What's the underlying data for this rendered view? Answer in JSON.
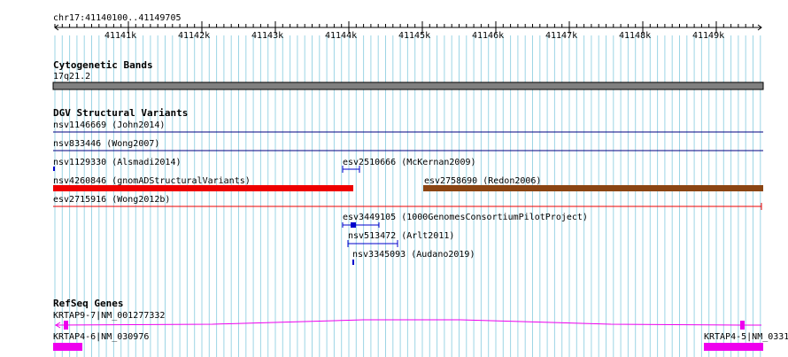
{
  "coords": "chr17:41140100..41149705",
  "ruler_ticks": [
    "41141k",
    "41142k",
    "41143k",
    "41144k",
    "41145k",
    "41146k",
    "41147k",
    "41148k",
    "41149k"
  ],
  "colors": {
    "grid": "#9dd5e5",
    "band": "#808080",
    "dgv_line": "#000080",
    "gnomad": "#ee0000",
    "redon": "#8b4513",
    "blue": "#0000cc",
    "refseq": "#ee00ee"
  },
  "tracks": {
    "cytoband": {
      "title": "Cytogenetic Bands",
      "band_label": "17q21.2"
    },
    "dgv": {
      "title": "DGV Structural Variants",
      "variants": [
        {
          "id": "nsv1146669",
          "label": "nsv1146669 (John2014)"
        },
        {
          "id": "nsv833446",
          "label": "nsv833446 (Wong2007)"
        },
        {
          "id": "nsv1129330",
          "label": "nsv1129330 (Alsmadi2014)"
        },
        {
          "id": "esv2510666",
          "label": "esv2510666 (McKernan2009)"
        },
        {
          "id": "nsv4260846",
          "label": "nsv4260846 (gnomADStructuralVariants)"
        },
        {
          "id": "esv2758690",
          "label": "esv2758690 (Redon2006)"
        },
        {
          "id": "esv2715916",
          "label": "esv2715916 (Wong2012b)"
        },
        {
          "id": "esv3449105",
          "label": "esv3449105 (1000GenomesConsortiumPilotProject)"
        },
        {
          "id": "nsv513472",
          "label": "nsv513472 (Arlt2011)"
        },
        {
          "id": "nsv3345093",
          "label": "nsv3345093 (Audano2019)"
        }
      ]
    },
    "refseq": {
      "title": "RefSeq Genes",
      "genes": [
        {
          "id": "krtap9-7",
          "label": "KRTAP9-7|NM_001277332"
        },
        {
          "id": "krtap4-6",
          "label": "KRTAP4-6|NM_030976"
        },
        {
          "id": "krtap4-5",
          "label": "KRTAP4-5|NM_0331"
        }
      ]
    }
  }
}
